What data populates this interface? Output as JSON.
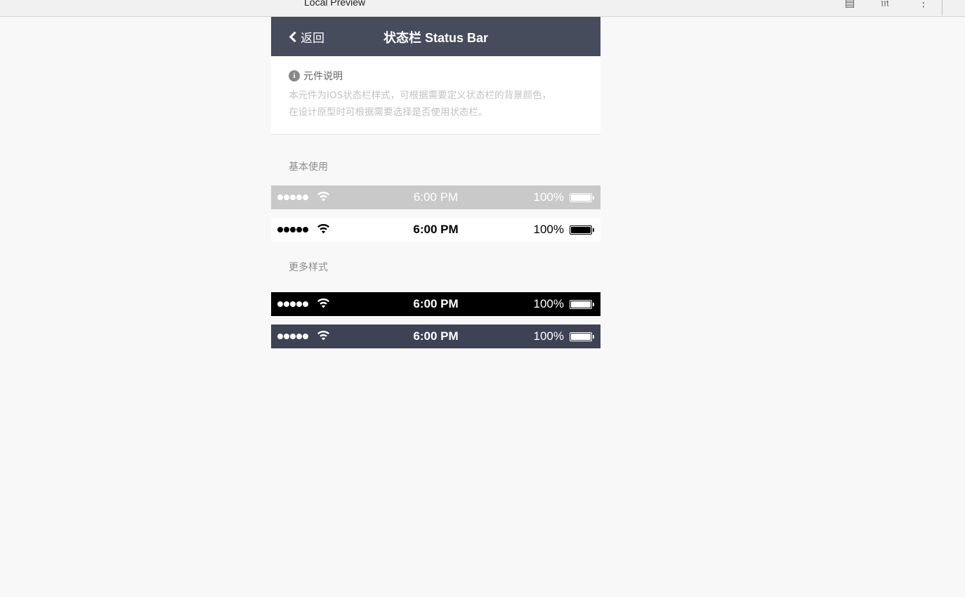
{
  "browser": {
    "tab_title": "Local Preview",
    "icons": [
      "reader-mode-icon",
      "translate-icon",
      "more-menu-icon"
    ]
  },
  "navbar": {
    "back_label": "返回",
    "title": "状态栏 Status Bar",
    "background": "#474c5c"
  },
  "description": {
    "heading": "元件说明",
    "line1": "本元件为IOS状态栏样式，可根据需要定义状态栏的背景颜色，",
    "line2": "在设计原型时可根据需要选择是否使用状态栏。"
  },
  "sections": {
    "basic": "基本使用",
    "more": "更多样式"
  },
  "status_bars": [
    {
      "style": "grey",
      "background": "#c9c9c9",
      "foreground": "#ffffff",
      "time": "6:00 PM",
      "battery_pct": "100%"
    },
    {
      "style": "white",
      "background": "#ffffff",
      "foreground": "#000000",
      "time": "6:00 PM",
      "battery_pct": "100%"
    },
    {
      "style": "black",
      "background": "#000000",
      "foreground": "#ffffff",
      "time": "6:00 PM",
      "battery_pct": "100%"
    },
    {
      "style": "slate",
      "background": "#3d4354",
      "foreground": "#ffffff",
      "time": "6:00 PM",
      "battery_pct": "100%"
    }
  ]
}
